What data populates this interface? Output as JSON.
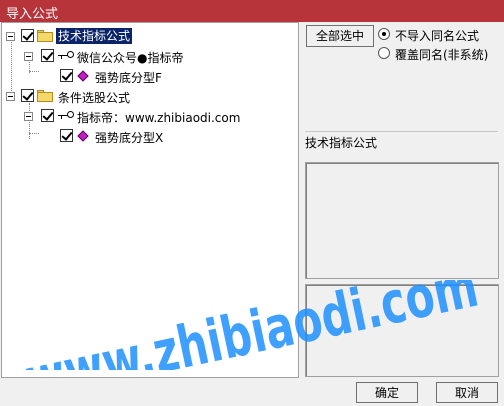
{
  "window": {
    "title": "导入公式"
  },
  "tree": {
    "root1": {
      "label": "技术指标公式"
    },
    "child1": {
      "label": "微信公众号●指标帝"
    },
    "leaf1": {
      "label": "强势底分型F"
    },
    "root2": {
      "label": "条件选股公式"
    },
    "child2": {
      "label": "指标帝：www.zhibiaodi.com"
    },
    "leaf2": {
      "label": "强势底分型X"
    }
  },
  "options": {
    "select_all_label": "全部选中",
    "radio1_label": "不导入同名公式",
    "radio2_label": "覆盖同名(非系统)",
    "selected": "radio1"
  },
  "detail": {
    "type_label": "技术指标公式"
  },
  "footer": {
    "ok_label": "确定",
    "cancel_label": "取消"
  },
  "watermark": {
    "text": "www.zhibiaodi.com"
  },
  "colors": {
    "titlebar": "#b8343b",
    "selection": "#0a246a",
    "watermark": "#1e90ff"
  }
}
